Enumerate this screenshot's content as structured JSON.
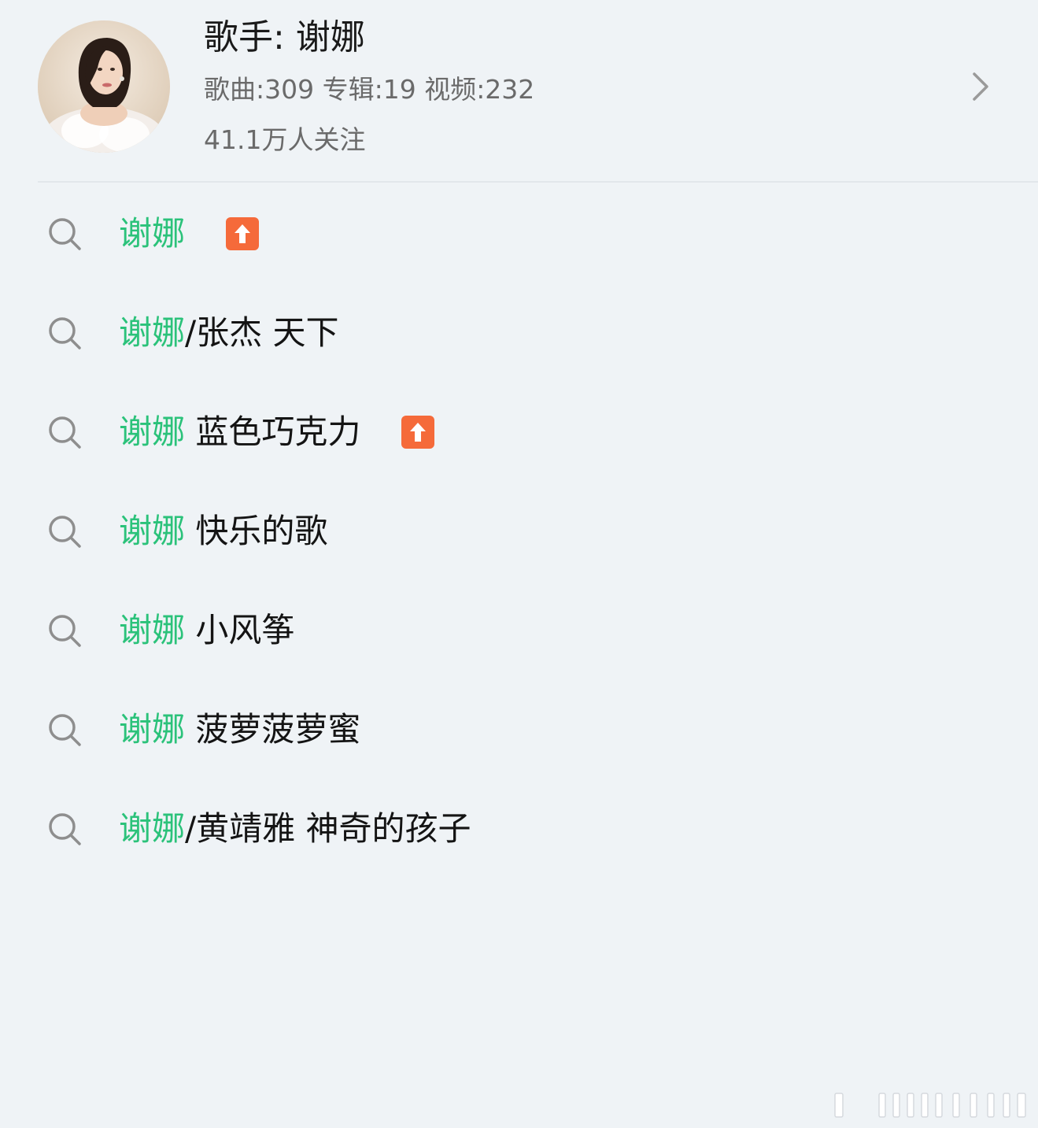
{
  "artist": {
    "name": "歌手: 谢娜",
    "stats": "歌曲:309 专辑:19 视频:232",
    "followers": "41.1万人关注",
    "avatar_icon": "artist-avatar",
    "chevron_icon": "chevron-right-icon"
  },
  "suggestions": [
    {
      "highlight": "谢娜",
      "text": "",
      "hot": true
    },
    {
      "highlight": "谢娜",
      "text": "/张杰 天下",
      "hot": false
    },
    {
      "highlight": "谢娜",
      "text": " 蓝色巧克力",
      "hot": true
    },
    {
      "highlight": "谢娜",
      "text": " 快乐的歌",
      "hot": false
    },
    {
      "highlight": "谢娜",
      "text": " 小风筝",
      "hot": false
    },
    {
      "highlight": "谢娜",
      "text": " 菠萝菠萝蜜",
      "hot": false
    },
    {
      "highlight": "谢娜",
      "text": "/黄靖雅 神奇的孩子",
      "hot": false
    }
  ],
  "colors": {
    "background": "#eff3f6",
    "highlight": "#2bc27a",
    "hot_badge": "#f56a3a",
    "secondary_text": "#6a6a6a"
  },
  "icons": {
    "search": "search-icon",
    "hot": "trending-up-arrow-icon"
  }
}
